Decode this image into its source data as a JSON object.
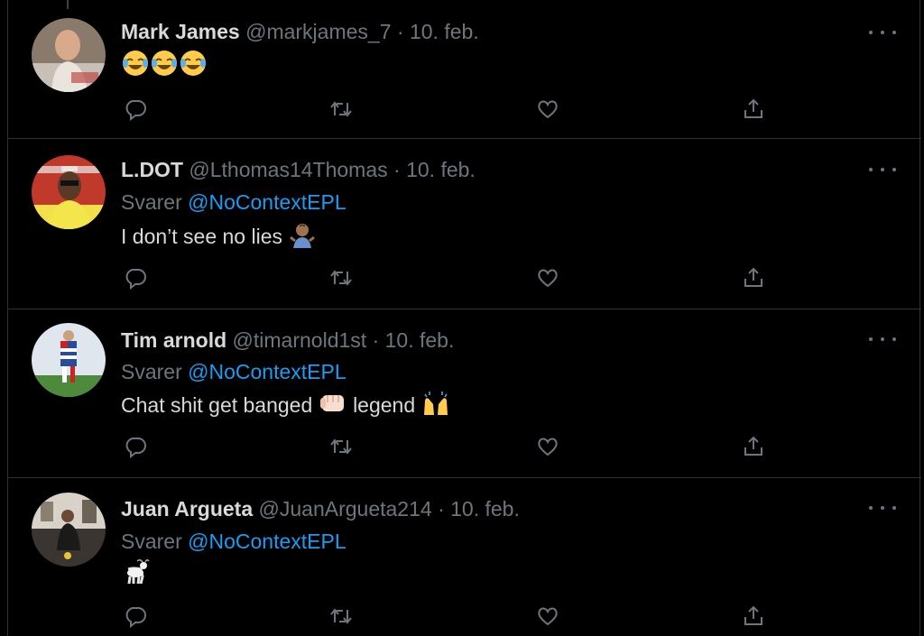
{
  "tweets": [
    {
      "name": "Mark James",
      "handle": "@markjames_7",
      "separator": "·",
      "date": "10. feb.",
      "reply_label": "",
      "reply_to": "",
      "text": "",
      "emojis": [
        "face-with-tears-of-joy",
        "face-with-tears-of-joy",
        "face-with-tears-of-joy"
      ]
    },
    {
      "name": "L.DOT",
      "handle": "@Lthomas14Thomas",
      "separator": "·",
      "date": "10. feb.",
      "reply_label": "Svarer",
      "reply_to": "@NoContextEPL",
      "text": "I don’t see no lies",
      "emojis": [
        "man-shrugging"
      ]
    },
    {
      "name": "Tim arnold",
      "handle": "@timarnold1st",
      "separator": "·",
      "date": "10. feb.",
      "reply_label": "Svarer",
      "reply_to": "@NoContextEPL",
      "text": "Chat shit get banged",
      "text2": "legend",
      "emojis": [
        "oncoming-fist",
        "raising-hands"
      ]
    },
    {
      "name": "Juan Argueta",
      "handle": "@JuanArgueta214",
      "separator": "·",
      "date": "10. feb.",
      "reply_label": "Svarer",
      "reply_to": "@NoContextEPL",
      "text": "",
      "emojis": [
        "goat"
      ]
    }
  ],
  "action_icons": [
    "reply-icon",
    "retweet-icon",
    "like-icon",
    "share-icon"
  ],
  "colors": {
    "background": "#000000",
    "border": "#2f3336",
    "primary_text": "#d9d9d9",
    "secondary_text": "#6e767d",
    "mention": "#1d9bf0"
  }
}
